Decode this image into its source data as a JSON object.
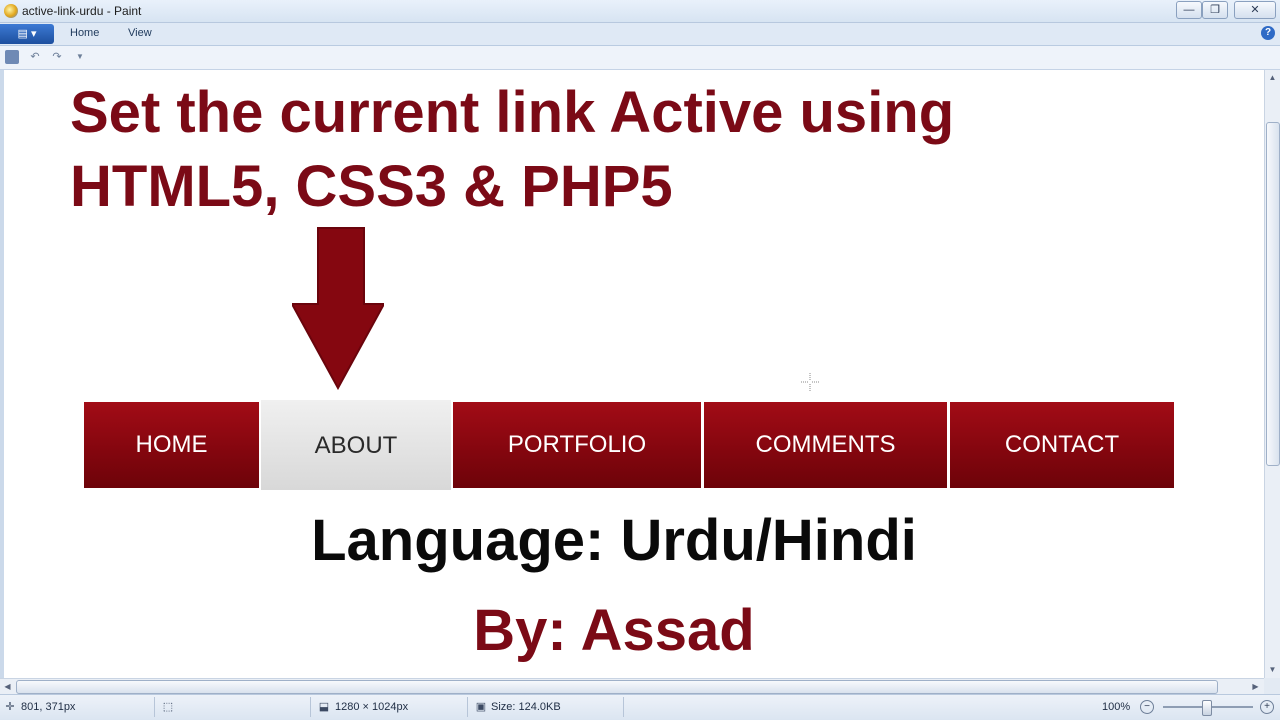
{
  "window": {
    "title": "active-link-urdu - Paint",
    "app_icon": "paint-palette-icon",
    "controls": [
      "minimize-icon",
      "maximize-icon",
      "close-icon"
    ]
  },
  "ribbon": {
    "tabs": [
      {
        "label": "Home"
      },
      {
        "label": "View"
      }
    ],
    "help_icon": "help-icon"
  },
  "qat": {
    "icons": [
      "save-icon",
      "undo-icon",
      "redo-icon",
      "customize-dropdown-icon"
    ]
  },
  "canvas": {
    "headline_line1": "Set the current link Active using",
    "headline_line2": "HTML5, CSS3 & PHP5",
    "nav": [
      {
        "label": "HOME",
        "active": false
      },
      {
        "label": "ABOUT",
        "active": true
      },
      {
        "label": "PORTFOLIO",
        "active": false
      },
      {
        "label": "COMMENTS",
        "active": false
      },
      {
        "label": "CONTACT",
        "active": false
      }
    ],
    "language": "Language: Urdu/Hindi",
    "author": "By: Assad",
    "colors": {
      "accent": "#7b0a16",
      "nav_red": "#8a0710",
      "nav_active": "#e6e6e6"
    }
  },
  "status": {
    "cursor_position": "801, 371px",
    "image_dimensions": "1280 × 1024px",
    "file_size": "Size: 124.0KB",
    "zoom": "100%"
  }
}
